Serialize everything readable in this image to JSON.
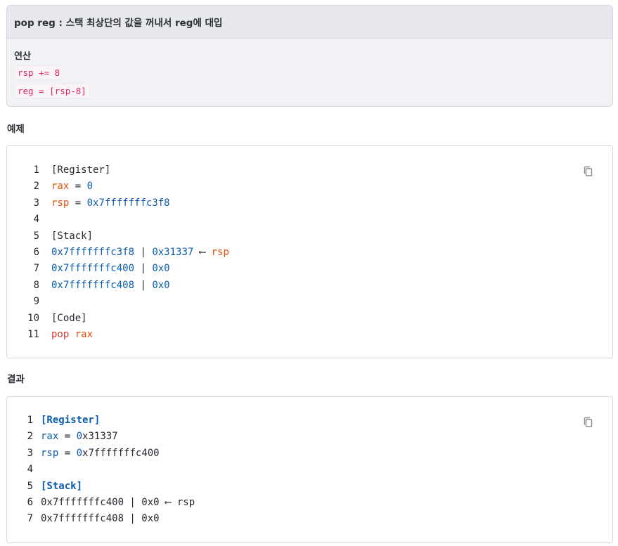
{
  "callout": {
    "title": "pop reg : 스택 최상단의 값을 꺼내서 reg에 대입",
    "op_label": "연산",
    "ops": [
      "rsp += 8",
      "reg = [rsp-8]"
    ]
  },
  "example": {
    "title": "예제",
    "lines": [
      {
        "n": "1",
        "tokens": [
          {
            "t": "[Register]",
            "c": "plain"
          }
        ]
      },
      {
        "n": "2",
        "tokens": [
          {
            "t": "rax",
            "c": "orange"
          },
          {
            "t": " = ",
            "c": "plain"
          },
          {
            "t": "0",
            "c": "blue"
          }
        ]
      },
      {
        "n": "3",
        "tokens": [
          {
            "t": "rsp",
            "c": "orange"
          },
          {
            "t": " = ",
            "c": "plain"
          },
          {
            "t": "0x7fffffffc3f8",
            "c": "blue"
          }
        ]
      },
      {
        "n": "4",
        "tokens": []
      },
      {
        "n": "5",
        "tokens": [
          {
            "t": "[Stack]",
            "c": "plain"
          }
        ]
      },
      {
        "n": "6",
        "tokens": [
          {
            "t": "0x7fffffffc3f8",
            "c": "blue"
          },
          {
            "t": " | ",
            "c": "plain"
          },
          {
            "t": "0x31337",
            "c": "blue"
          },
          {
            "t": " ⟵ ",
            "c": "plain"
          },
          {
            "t": "rsp",
            "c": "orange"
          }
        ]
      },
      {
        "n": "7",
        "tokens": [
          {
            "t": "0x7fffffffc400",
            "c": "blue"
          },
          {
            "t": " | ",
            "c": "plain"
          },
          {
            "t": "0x0",
            "c": "blue"
          }
        ]
      },
      {
        "n": "8",
        "tokens": [
          {
            "t": "0x7fffffffc408",
            "c": "blue"
          },
          {
            "t": " | ",
            "c": "plain"
          },
          {
            "t": "0x0",
            "c": "blue"
          }
        ]
      },
      {
        "n": "9",
        "tokens": []
      },
      {
        "n": "10",
        "tokens": [
          {
            "t": "[Code]",
            "c": "plain"
          }
        ]
      },
      {
        "n": "11",
        "tokens": [
          {
            "t": "pop",
            "c": "red"
          },
          {
            "t": " ",
            "c": "plain"
          },
          {
            "t": "rax",
            "c": "orange"
          }
        ]
      }
    ]
  },
  "result": {
    "title": "결과",
    "lines": [
      {
        "n": "1",
        "tokens": [
          {
            "t": "[Register]",
            "c": "blue bold"
          }
        ]
      },
      {
        "n": "2",
        "tokens": [
          {
            "t": "rax",
            "c": "blue"
          },
          {
            "t": " = ",
            "c": "plain"
          },
          {
            "t": "0",
            "c": "blue"
          },
          {
            "t": "x31337",
            "c": "plain"
          }
        ]
      },
      {
        "n": "3",
        "tokens": [
          {
            "t": "rsp",
            "c": "blue"
          },
          {
            "t": " = ",
            "c": "plain"
          },
          {
            "t": "0",
            "c": "blue"
          },
          {
            "t": "x7fffffffc400",
            "c": "plain"
          }
        ]
      },
      {
        "n": "4",
        "tokens": []
      },
      {
        "n": "5",
        "tokens": [
          {
            "t": "[Stack]",
            "c": "blue bold"
          }
        ]
      },
      {
        "n": "6",
        "tokens": [
          {
            "t": "0x7fffffffc400 | 0x0 ⟵ rsp",
            "c": "plain"
          }
        ]
      },
      {
        "n": "7",
        "tokens": [
          {
            "t": "0x7fffffffc408 | 0x0",
            "c": "plain"
          }
        ]
      }
    ]
  },
  "icons": {
    "copy": "copy-icon"
  }
}
